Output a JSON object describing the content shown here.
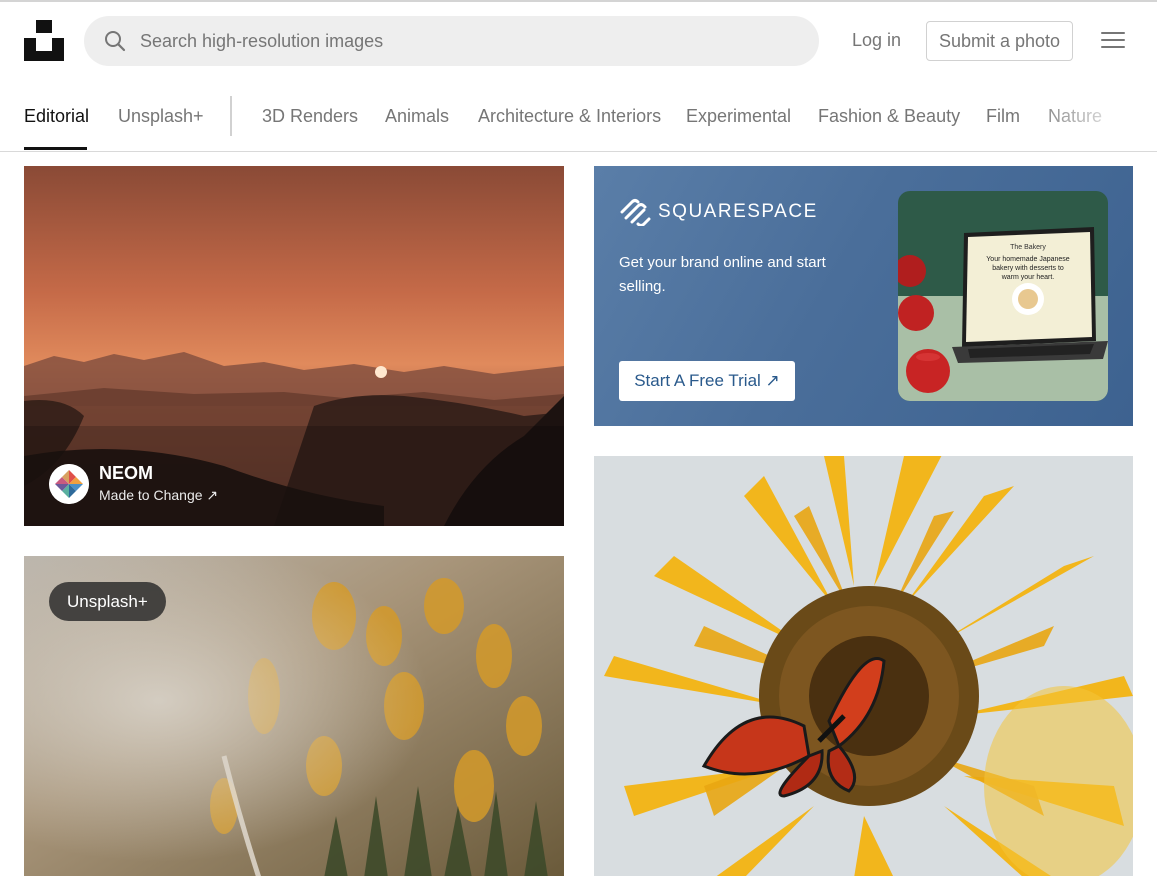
{
  "header": {
    "search_placeholder": "Search high-resolution images",
    "login_label": "Log in",
    "submit_label": "Submit a photo"
  },
  "topics": {
    "items": [
      "Editorial",
      "Unsplash+",
      "3D Renders",
      "Animals",
      "Architecture & Interiors",
      "Experimental",
      "Fashion & Beauty",
      "Film",
      "Nature"
    ],
    "active": "Editorial"
  },
  "feed": {
    "sponsored": {
      "name": "NEOM",
      "tagline": "Made to Change ↗"
    },
    "unsplash_plus_badge": "Unsplash+"
  },
  "ad": {
    "brand": "SQUARESPACE",
    "copy": "Get your brand online and start selling.",
    "cta": "Start A Free Trial ↗",
    "screen_title": "Your homemade Japanese bakery with desserts to warm your heart."
  },
  "colors": {
    "accent_text": "#111111",
    "muted_text": "#767676",
    "ad_background": "#4a6e9a",
    "cta_text": "#2a5a8c"
  },
  "icons": {
    "logo": "unsplash-logo-icon",
    "search": "search-icon",
    "menu": "hamburger-menu-icon",
    "ad_logo": "squarespace-logo-icon"
  }
}
